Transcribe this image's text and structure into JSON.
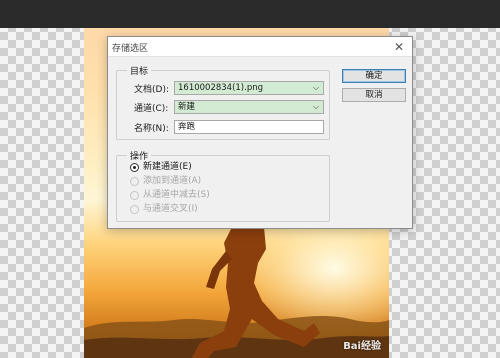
{
  "dialog": {
    "title": "存储选区",
    "close_glyph": "✕",
    "target_group": {
      "legend": "目标",
      "document_label": "文档(D):",
      "document_value": "1610002834(1).png",
      "channel_label": "通道(C):",
      "channel_value": "新建",
      "name_label": "名称(N):",
      "name_value": "奔跑"
    },
    "operation_group": {
      "legend": "操作",
      "options": [
        {
          "label": "新建通道(E)",
          "checked": true,
          "enabled": true
        },
        {
          "label": "添加到通道(A)",
          "checked": false,
          "enabled": false
        },
        {
          "label": "从通道中减去(S)",
          "checked": false,
          "enabled": false
        },
        {
          "label": "与通道交叉(I)",
          "checked": false,
          "enabled": false
        }
      ]
    },
    "buttons": {
      "ok": "确定",
      "cancel": "取消"
    }
  },
  "chevron_glyph": "⌵",
  "watermark": "Bai经验"
}
